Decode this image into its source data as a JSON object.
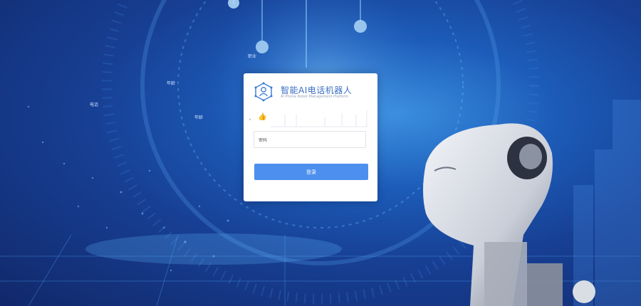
{
  "background": {
    "labels": [
      "职业",
      "年龄",
      "电话",
      "年龄"
    ],
    "colors": {
      "deep": "#11286a",
      "mid": "#1c5bb8",
      "glow": "#3a8fe0"
    }
  },
  "login": {
    "logo_icon": "people-network-icon",
    "title": "智能AI电话机器人",
    "subtitle": "AI Phone Robot Management Platform",
    "account_tiny_label": "ıı",
    "account_icon": "thumb-icon",
    "password_placeholder": "密码",
    "login_button": "登录",
    "button_color": "#4c8fee"
  }
}
